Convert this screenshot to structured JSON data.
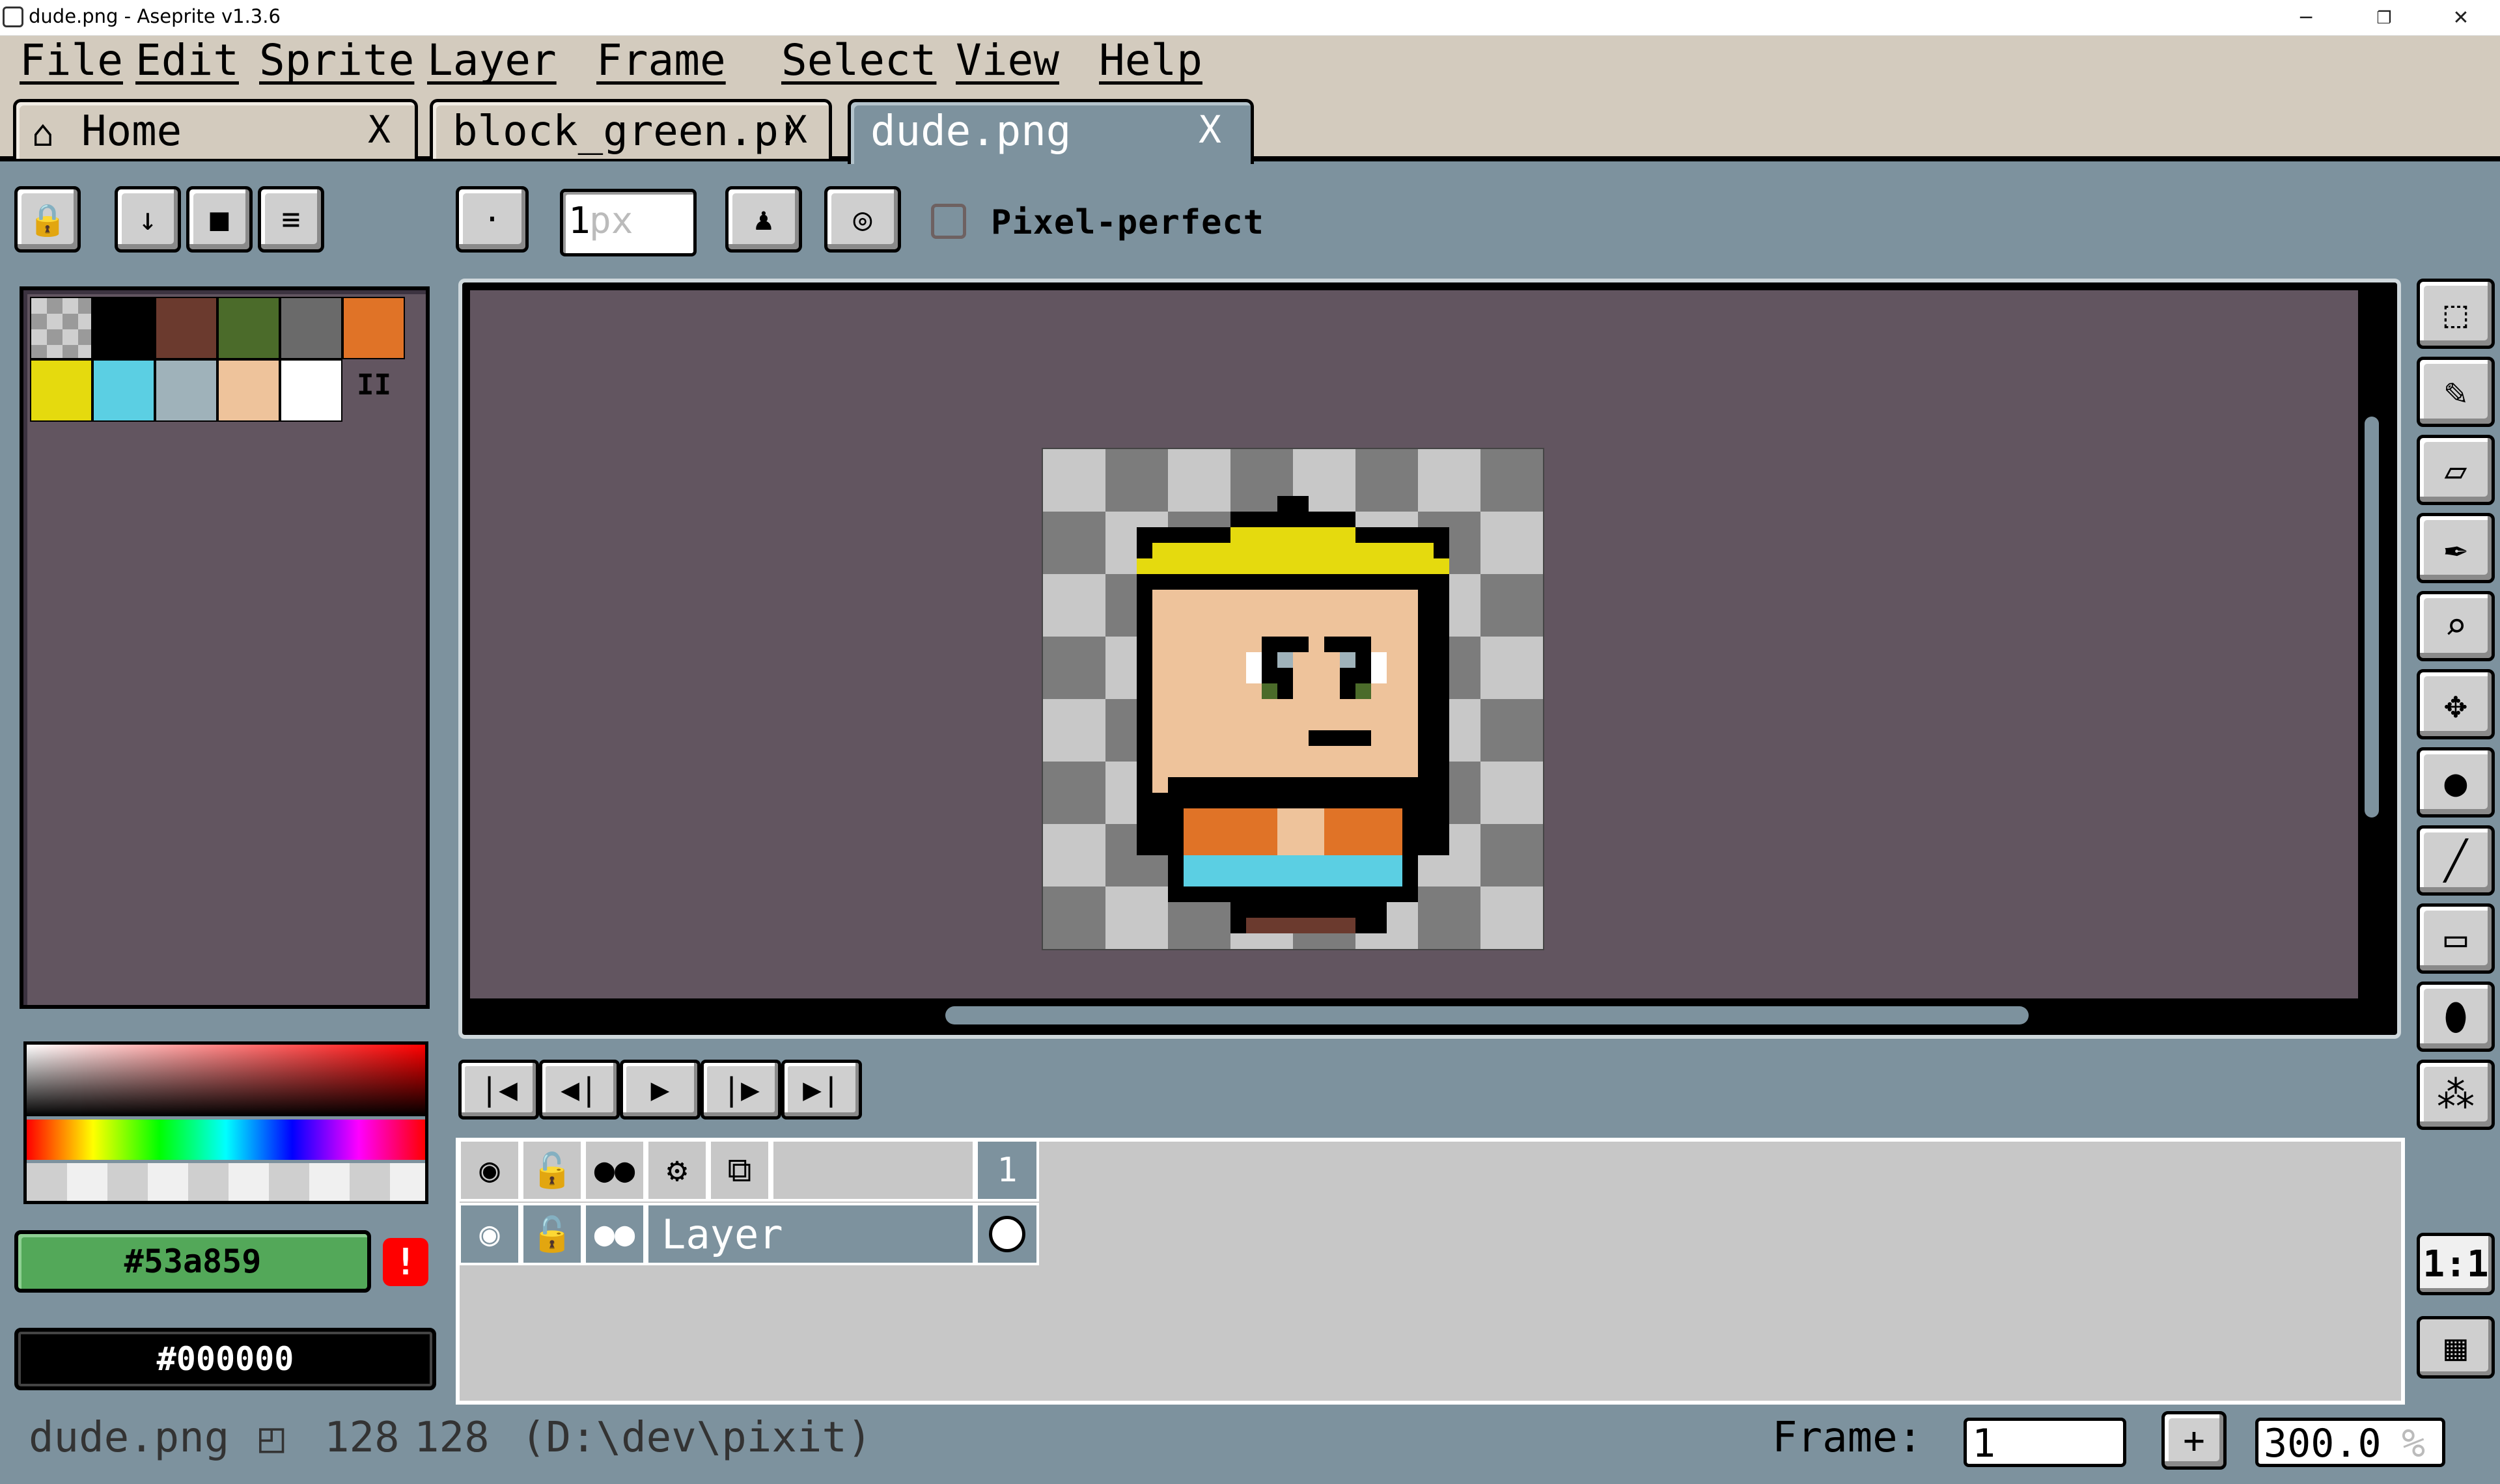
{
  "window": {
    "title": "dude.png - Aseprite v1.3.6",
    "minimize": "─",
    "restore": "❐",
    "close": "✕"
  },
  "menu": [
    "File",
    "Edit",
    "Sprite",
    "Layer",
    "Frame",
    "Select",
    "View",
    "Help"
  ],
  "tabs": [
    {
      "label": "Home",
      "icon": "home-icon",
      "close": "X"
    },
    {
      "label": "block_green.pr",
      "close": "X"
    },
    {
      "label": "dude.png",
      "close": "X",
      "active": true
    }
  ],
  "toolbar": {
    "brush_size_value": "1",
    "brush_size_unit": "px",
    "pixel_perfect_label": "Pixel-perfect",
    "pixel_perfect_checked": false
  },
  "palette": {
    "swatches": [
      "transparent",
      "#000000",
      "#6b3a2e",
      "#4b6b2a",
      "#6a6a6a",
      "#e07327",
      "#e5da0e",
      "#5bcfe3",
      "#9fb2ba",
      "#eec39b",
      "#ffffff"
    ],
    "more": "II"
  },
  "colors": {
    "foreground": "#53a859",
    "background": "#000000",
    "warning": "!"
  },
  "playback": {
    "first": "|◀",
    "prev": "◀|",
    "play": "▶",
    "next": "|▶",
    "last": "▶|"
  },
  "timeline": {
    "frame_header": "1",
    "layer_name": "Layer"
  },
  "right_tools": [
    "marquee-icon",
    "pencil-icon",
    "eraser-icon",
    "eyedropper-icon",
    "zoom-icon",
    "move-icon",
    "fill-icon",
    "line-icon",
    "rectangle-icon",
    "blur-icon",
    "spray-icon"
  ],
  "bottom_right": {
    "one_to_one": "1:1",
    "filmstrip": "filmstrip-icon"
  },
  "status": {
    "filename": "dude.png",
    "width": "128",
    "height": "128",
    "path": "(D:\\dev\\pixit)",
    "frame_label": "Frame:",
    "frame_value": "1",
    "add_frame": "+",
    "zoom_value": "300.0",
    "zoom_unit": "%"
  }
}
